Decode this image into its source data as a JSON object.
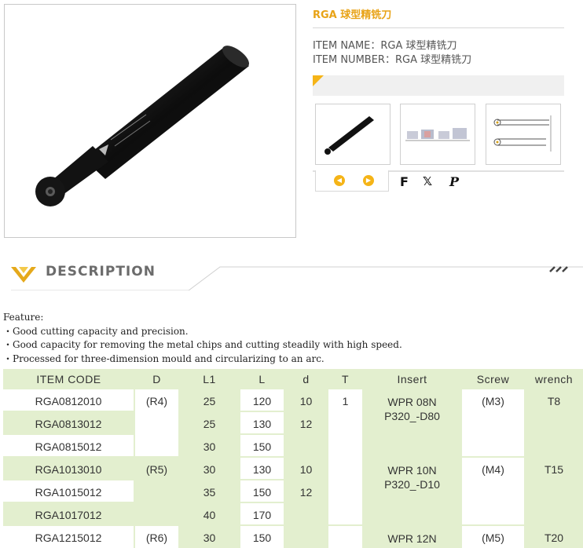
{
  "product": {
    "title": "RGA 球型精铣刀",
    "item_name": "ITEM NAME：RGA 球型精铣刀",
    "item_number": "ITEM NUMBER：RGA 球型精铣刀"
  },
  "nav": {
    "prev_label": "◀",
    "next_label": "▶"
  },
  "share": {
    "facebook": "F",
    "twitter": "𝕏",
    "pinterest": "P"
  },
  "description": {
    "title": "DESCRIPTION"
  },
  "features": {
    "heading": "Feature:",
    "items": [
      "・Good cutting capacity and precision.",
      "・Good capacity for removing the metal chips and cutting steadily with high speed.",
      "・Processed for three-dimension mould and circularizing to an arc."
    ]
  },
  "table": {
    "headers": [
      "ITEM  CODE",
      "D",
      "L1",
      "L",
      "d",
      "T",
      "Insert",
      "Screw",
      "wrench"
    ],
    "rows": [
      [
        "RGA0812010",
        "(R4)",
        "25",
        "120",
        "10",
        "1",
        "WPR 08N",
        "(M3)",
        "T8"
      ],
      [
        "RGA0813012",
        "",
        "25",
        "130",
        "12",
        "",
        "P320_-D80",
        "",
        ""
      ],
      [
        "RGA0815012",
        "",
        "30",
        "150",
        "",
        "",
        "",
        "",
        ""
      ],
      [
        "RGA1013010",
        "(R5)",
        "30",
        "130",
        "10",
        "",
        "WPR 10N",
        "(M4)",
        "T15"
      ],
      [
        "RGA1015012",
        "",
        "35",
        "150",
        "12",
        "",
        "P320_-D10",
        "",
        ""
      ],
      [
        "RGA1017012",
        "",
        "40",
        "170",
        "",
        "",
        "",
        "",
        ""
      ],
      [
        "RGA1215012",
        "(R6)",
        "30",
        "150",
        "",
        "",
        "WPR 12N",
        "(M5)",
        "T20"
      ]
    ]
  }
}
